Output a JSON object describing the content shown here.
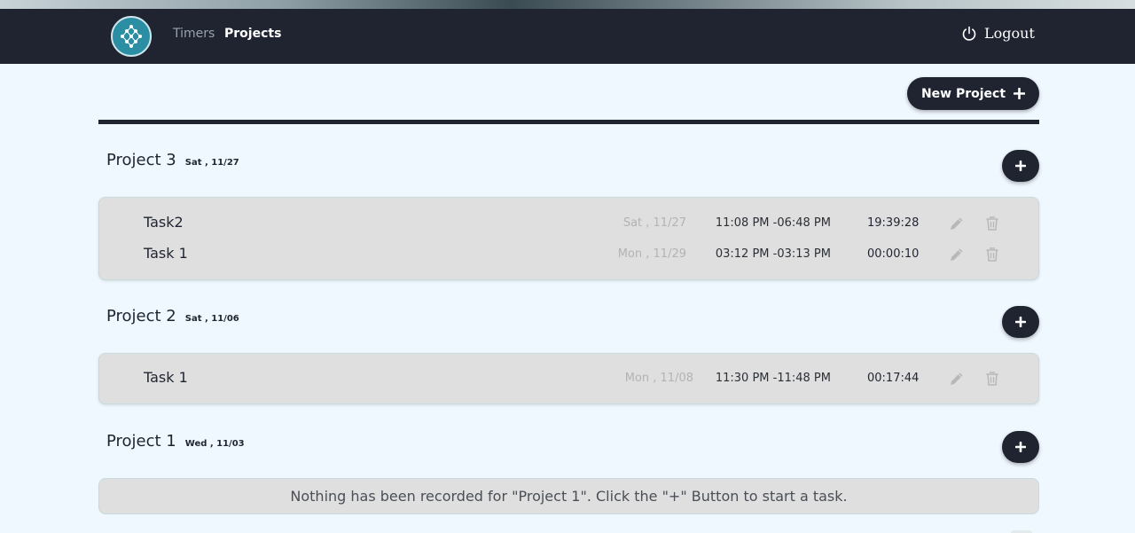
{
  "nav": {
    "links": [
      "Timers",
      "Projects"
    ],
    "logout_label": "Logout"
  },
  "toolbar": {
    "new_project_label": "New Project"
  },
  "icons": {
    "logo": "network-logo-icon",
    "logout": "power-icon",
    "add": "plus-icon",
    "edit": "pencil-icon",
    "delete": "trash-icon"
  },
  "colors": {
    "navbar": "#1f2430",
    "page_bg": "#f0f8ff",
    "task_box": "#dfdfdf",
    "logo_accent": "#2c8ea3"
  },
  "projects": [
    {
      "name": "Project 3",
      "date": "Sat , 11/27",
      "tasks": [
        {
          "name": "Task2",
          "date": "Sat , 11/27",
          "time_range": "11:08 PM -06:48 PM",
          "duration": "19:39:28"
        },
        {
          "name": "Task 1",
          "date": "Mon , 11/29",
          "time_range": "03:12 PM -03:13 PM",
          "duration": "00:00:10"
        }
      ]
    },
    {
      "name": "Project 2",
      "date": "Sat , 11/06",
      "tasks": [
        {
          "name": "Task 1",
          "date": "Mon , 11/08",
          "time_range": "11:30 PM -11:48 PM",
          "duration": "00:17:44"
        }
      ]
    },
    {
      "name": "Project 1",
      "date": "Wed , 11/03",
      "tasks": [],
      "empty_message": "Nothing has been recorded for \"Project 1\". Click the \"+\" Button to start a task."
    }
  ]
}
